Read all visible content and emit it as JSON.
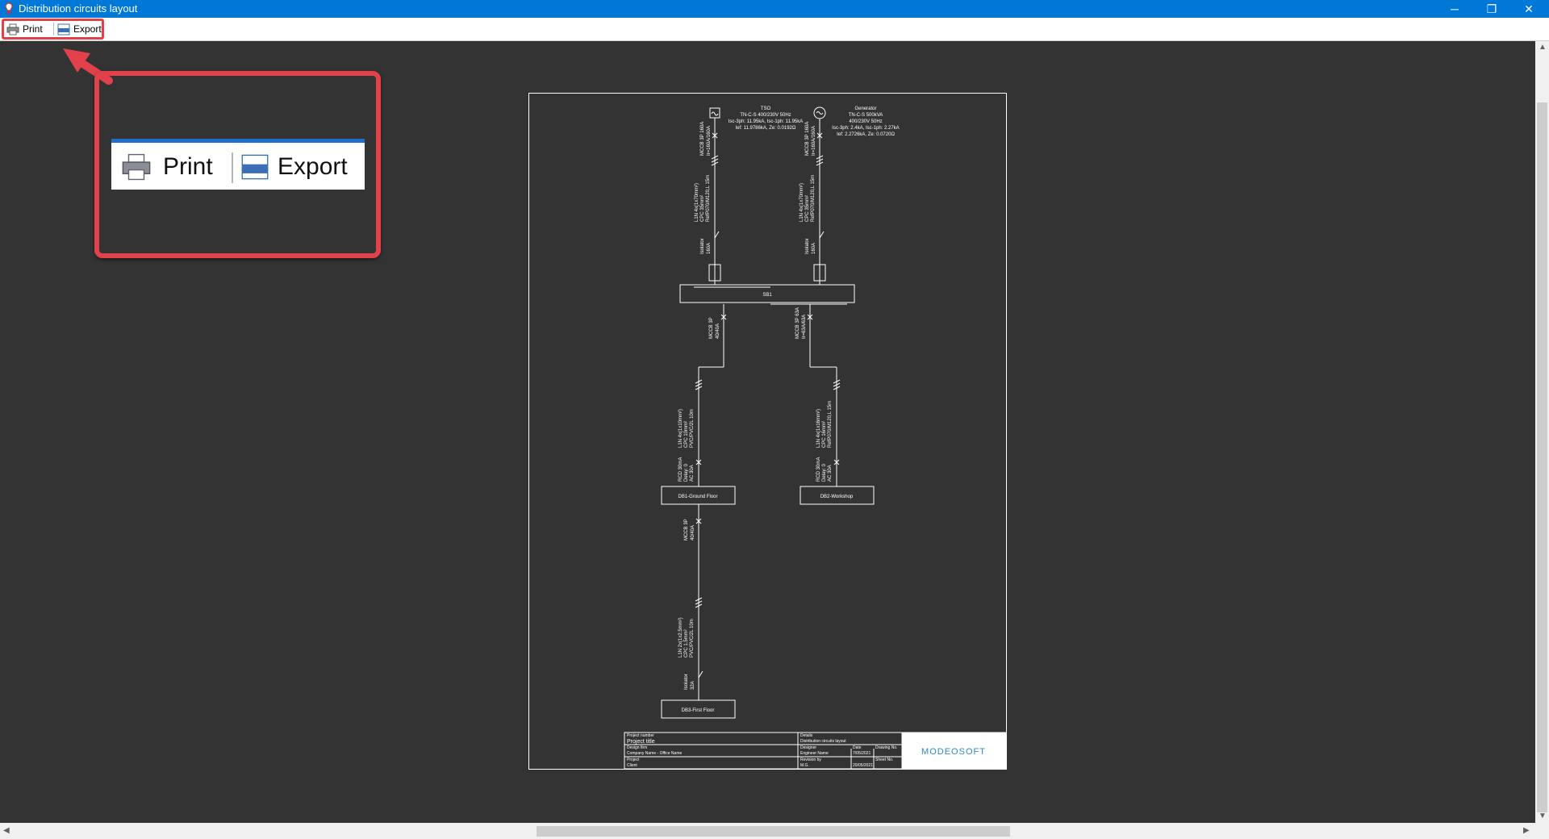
{
  "window": {
    "title": "Distribution circuits layout",
    "minimize_glyph": "─",
    "maximize_glyph": "❐",
    "close_glyph": "✕",
    "icon": "app-bulb-icon"
  },
  "toolbar": {
    "print_label": "Print",
    "export_label": "Export",
    "print_icon": "printer-icon",
    "export_icon": "dxf-file-icon"
  },
  "callout": {
    "print_label": "Print",
    "export_label": "Export",
    "highlight_color": "#e0414b"
  },
  "drawing": {
    "tso_title": "TSO",
    "tso_lines": [
      "TN-C-S 400/230V 50Hz",
      "Isc-3ph: 11.95kA, Isc-1ph: 11.95kA",
      "Ief: 11.9786kA, Ze: 0.0192Ω"
    ],
    "gen_title": "Generator",
    "gen_lines": [
      "TN-C-S 500kVA",
      "400/230V 50Hz",
      "Isc-3ph: 2.4kA, Isc-1ph: 2.27kA",
      "Ief: 2.2726kA, Ze: 0.0720Ω"
    ],
    "src_breaker": [
      "MCCB 3P 160A",
      "Ir=160A/160A"
    ],
    "src_cable": [
      "L1N 4x(1x70mm²)",
      "CPC 35mm²",
      "RefP070/M120,L 15m"
    ],
    "src_isolator": [
      "Isolator",
      "160A"
    ],
    "sb_label": "SB1",
    "feed_breaker_left": [
      "MCCB 3P",
      "40/40A"
    ],
    "feed_breaker_right": [
      "MCCB 3P 63A",
      "Ir=63A/63A"
    ],
    "feed_cable_left": [
      "L1N 4x(1x10mm²)",
      "CPC 10mm²",
      "PVC/PVC/2L 10m"
    ],
    "feed_cable_right": [
      "L1N 4x(1x16mm²)",
      "CPC 16mm²",
      "RefP070/M120,L 15m"
    ],
    "rcd_left": [
      "RCD 30mA",
      "Delay: 0",
      "AC 30A"
    ],
    "rcd_right": [
      "RCD 30mA",
      "Delay: 0",
      "AC 30A"
    ],
    "db1_label": "DB1-Ground Floor",
    "db2_label": "DB2-Workshop",
    "sub_breaker": [
      "MCCB 3P",
      "40/40A"
    ],
    "sub_cable": [
      "L1N 2x(1x2.5mm²)",
      "CPC 1.5mm²",
      "PVC/PVC/2L 10m"
    ],
    "sub_isolator": [
      "Isolator",
      "32A"
    ],
    "db3_label": "DB3-First Floor",
    "titleblock": {
      "project_number_label": "Project number",
      "project_title": "Project title",
      "design_firm_label": "Design firm",
      "company": "Company Name - Office Name",
      "project_label": "Project",
      "client": "Client",
      "details_label": "Details",
      "details": "Distribution circuits layout",
      "designer_label": "Designer",
      "designer": "Engineer Name",
      "revision_label": "Revision by",
      "revision": "M.G.",
      "date_label": "Date",
      "date1": "7/05/2021",
      "drawing_label": "Drawing No.",
      "sheet_label": "Sheet No.",
      "date2": "20/05/2021",
      "logo": "MODEOSOFT"
    }
  }
}
